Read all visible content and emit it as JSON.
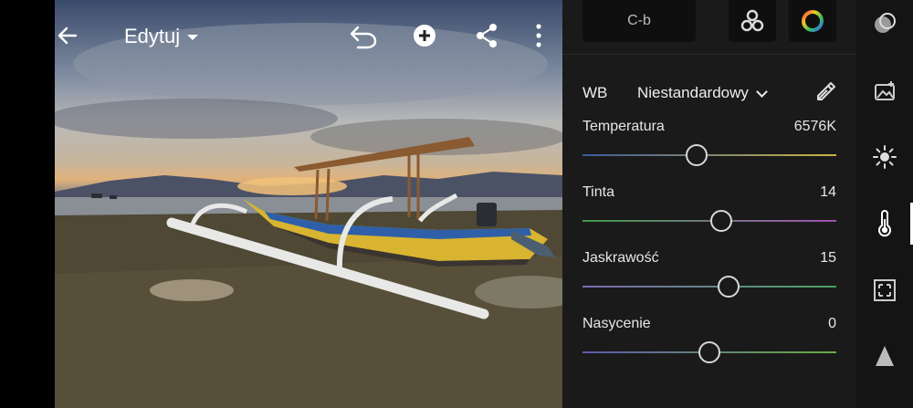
{
  "header": {
    "title": "Edytuj",
    "back_icon": "arrow-left-icon",
    "undo_icon": "undo-icon",
    "add_icon": "add-circle-icon",
    "share_icon": "share-icon",
    "more_icon": "more-vertical-icon"
  },
  "panel": {
    "preset_label": "C-b",
    "wb": {
      "label": "WB",
      "value": "Niestandardowy"
    },
    "sliders": [
      {
        "label": "Temperatura",
        "value": "6576K",
        "position": 0.45,
        "colors": [
          "#3c5a9c",
          "#c9b440"
        ]
      },
      {
        "label": "Tinta",
        "value": "14",
        "position": 0.545,
        "colors": [
          "#3f9a4a",
          "#a050b0"
        ]
      },
      {
        "label": "Jaskrawość",
        "value": "15",
        "position": 0.575,
        "colors": [
          "#7a6ab0",
          "#4aa060"
        ]
      },
      {
        "label": "Nasycenie",
        "value": "0",
        "position": 0.5,
        "colors": [
          "#5a5ab0",
          "#6aaa40"
        ]
      }
    ]
  },
  "tools": [
    "presets-icon",
    "image-adjust-icon",
    "light-icon",
    "color-temperature-icon",
    "crop-icon",
    "effects-icon"
  ],
  "accent": "#ffffff"
}
